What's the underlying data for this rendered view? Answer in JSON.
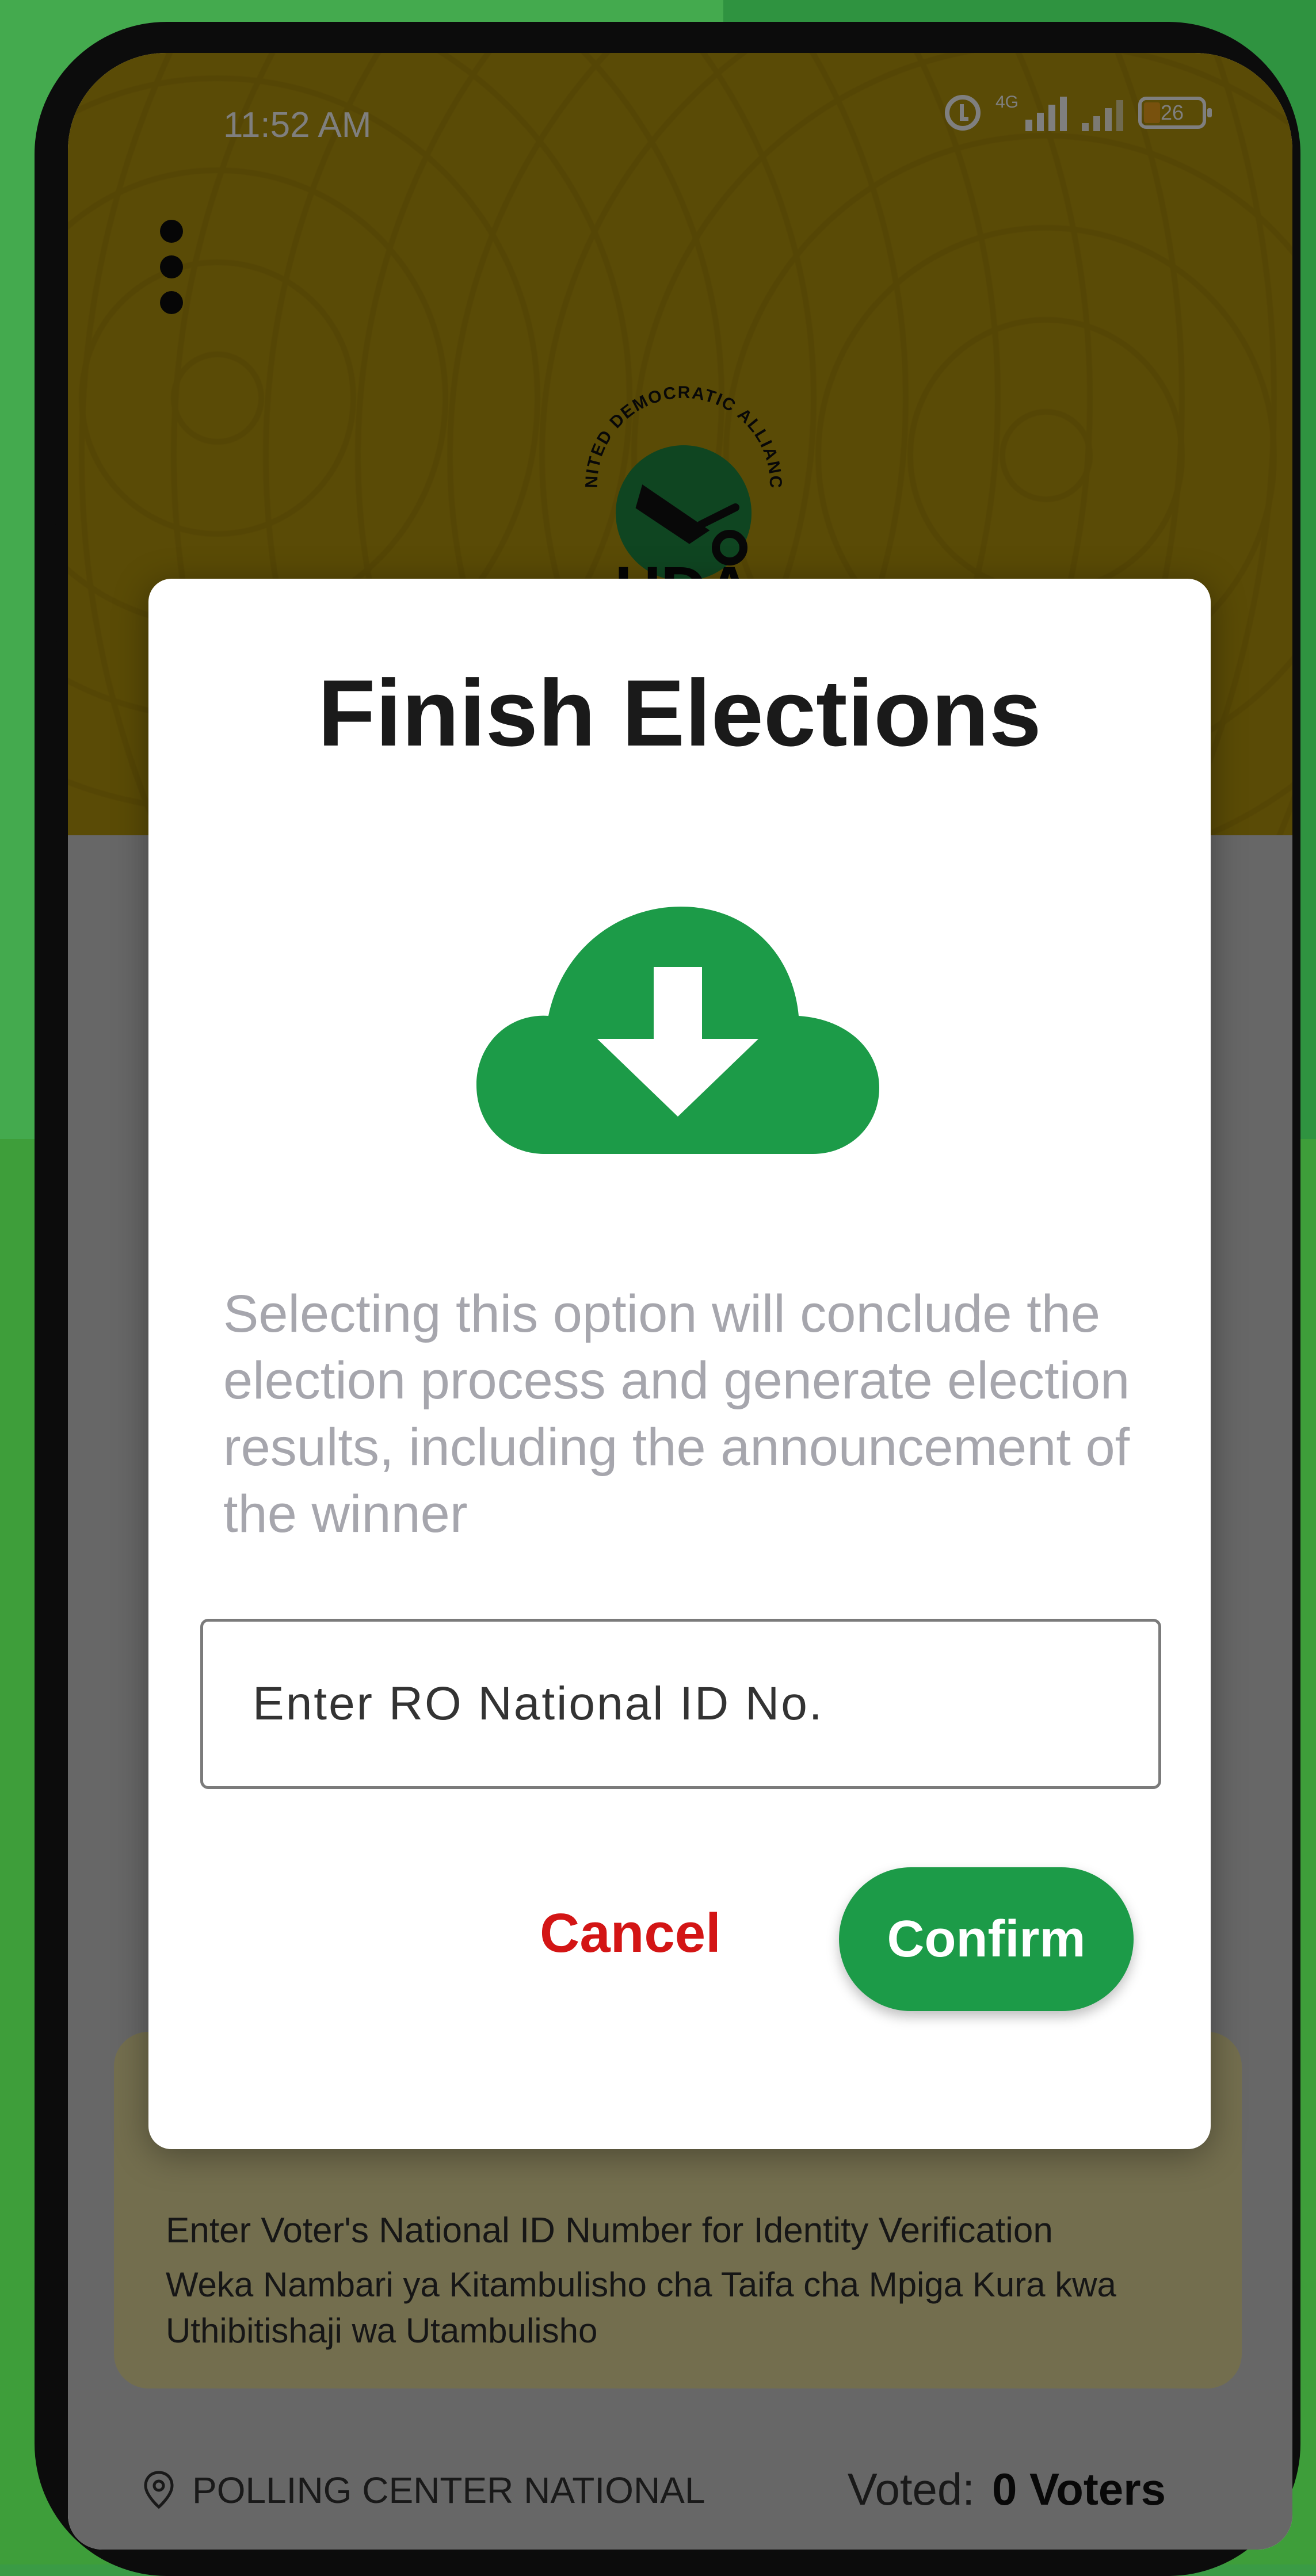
{
  "status_bar": {
    "time": "11:52 AM",
    "network": "4G",
    "battery": "26"
  },
  "app": {
    "logo_arc_text": "UNITED DEMOCRATIC ALLIANCE",
    "logo_wordmark": "UDA"
  },
  "dialog": {
    "title": "Finish Elections",
    "description": "Selecting this option will conclude the election process and generate election results, including the announcement of the winner",
    "id_placeholder": "Enter RO National ID No.",
    "cancel_label": "Cancel",
    "confirm_label": "Confirm",
    "icon": "cloud-download-icon"
  },
  "voter_card": {
    "english": "Enter Voter's National ID Number for Identity Verification",
    "swahili": "Weka Nambari ya Kitambulisho cha Taifa cha Mpiga Kura kwa Uthibitishaji wa Utambulisho"
  },
  "footer": {
    "polling_center": "POLLING CENTER NATIONAL",
    "voted_label": "Voted:",
    "voted_count": "0 Voters"
  },
  "colors": {
    "header": "#b5960d",
    "accent_green": "#1c9b48",
    "cancel_red": "#d31515",
    "card_yellow": "#e7dd9c"
  }
}
